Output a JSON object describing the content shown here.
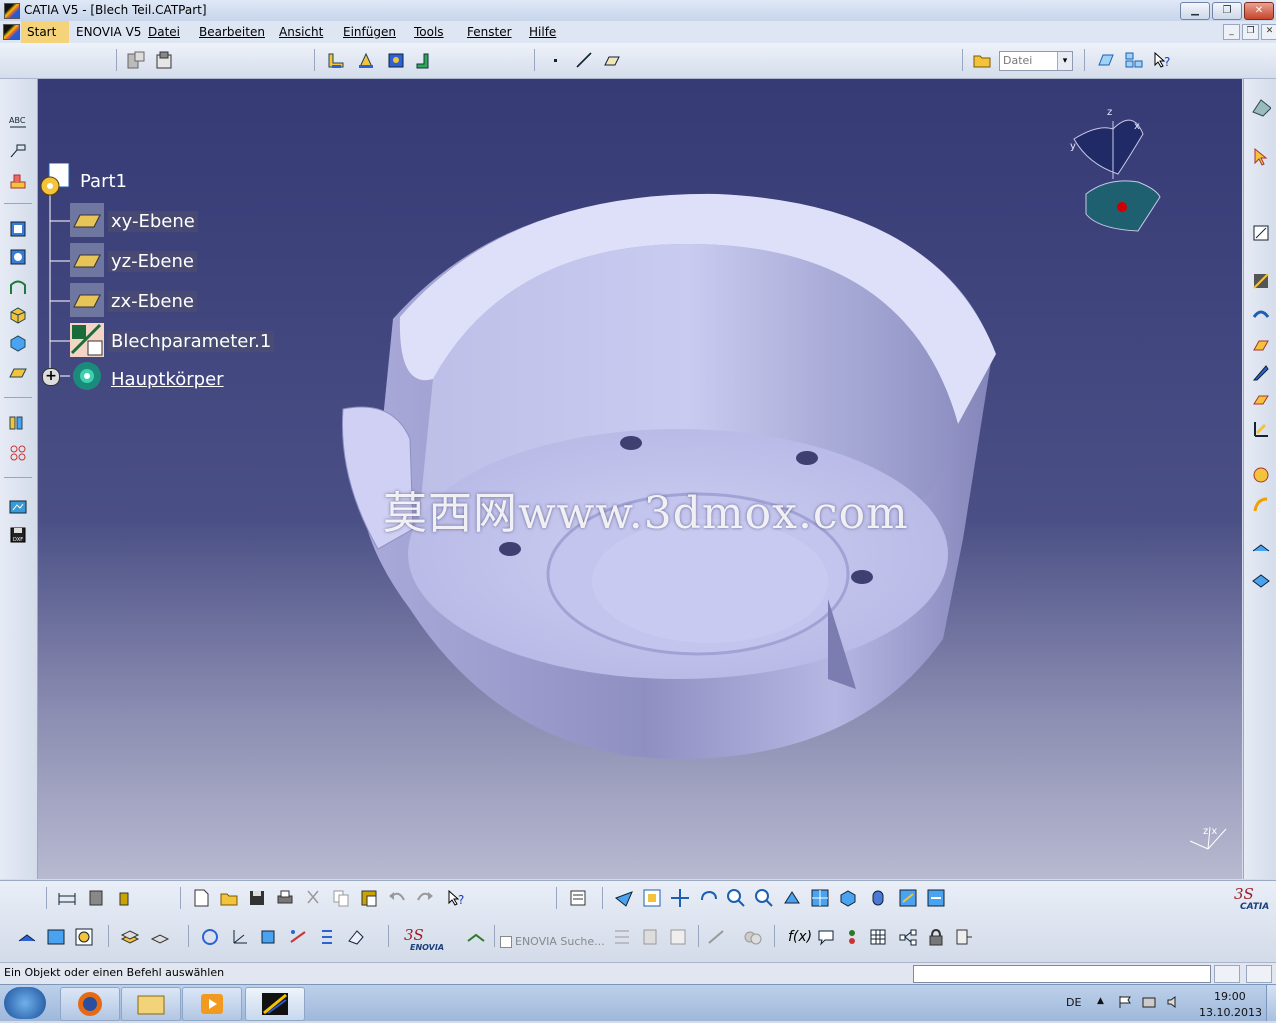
{
  "window": {
    "title": "CATIA V5 - [Blech Teil.CATPart]",
    "minimize": "▁",
    "maximize": "❐",
    "close": "✕"
  },
  "menu": {
    "start": "Start",
    "enovia": "ENOVIA V5",
    "datei": "Datei",
    "bearbeiten": "Bearbeiten",
    "ansicht": "Ansicht",
    "einfuegen": "Einfügen",
    "tools": "Tools",
    "fenster": "Fenster",
    "hilfe": "Hilfe"
  },
  "toolbar": {
    "workbench_select_value": "Datei"
  },
  "tree": {
    "root": "Part1",
    "items": [
      {
        "label": "xy-Ebene"
      },
      {
        "label": "yz-Ebene"
      },
      {
        "label": "zx-Ebene"
      },
      {
        "label": "Blechparameter.1"
      },
      {
        "label": "Hauptkörper"
      }
    ]
  },
  "viewport": {
    "watermark": "莫西网www.3dmox.com",
    "compass_z": "z",
    "compass_x": "x",
    "compass_y": "y",
    "axis_label": "z x"
  },
  "bottom": {
    "enovia_search": "ENOVIA Suche...",
    "catia_logo": "CATIA",
    "enovia_logo": "ENOVIA",
    "fx": "f(x)"
  },
  "status": {
    "message": "Ein Objekt oder einen Befehl auswählen"
  },
  "taskbar": {
    "lang": "DE",
    "time": "19:00",
    "date": "13.10.2013"
  },
  "colors": {
    "viewport_top": "#363a75",
    "part_face": "#c7c8ee",
    "accent_red": "#cc0000"
  }
}
